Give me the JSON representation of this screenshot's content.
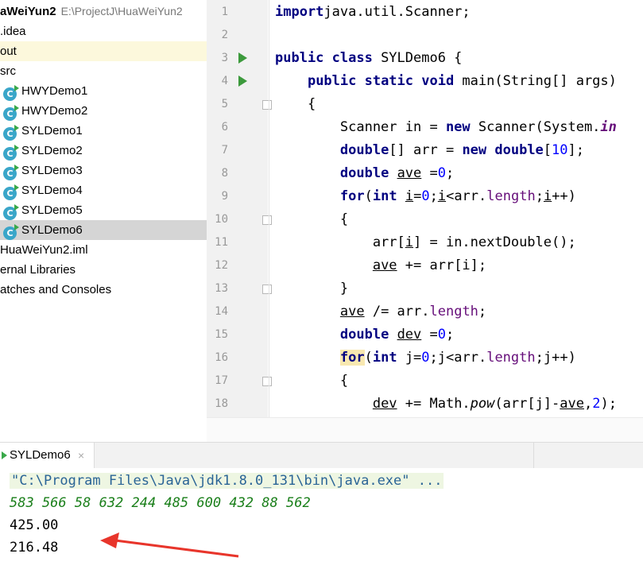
{
  "project": {
    "root_name": "aWeiYun2",
    "root_path": "E:\\ProjectJ\\HuaWeiYun2",
    "items": [
      {
        "label": ".idea",
        "indent": 0,
        "icon": "",
        "state": ""
      },
      {
        "label": "out",
        "indent": 0,
        "icon": "",
        "state": "highlight"
      },
      {
        "label": "src",
        "indent": 0,
        "icon": "",
        "state": ""
      },
      {
        "label": "HWYDemo1",
        "indent": 1,
        "icon": "java-class-icon",
        "state": ""
      },
      {
        "label": "HWYDemo2",
        "indent": 1,
        "icon": "java-class-icon",
        "state": ""
      },
      {
        "label": "SYLDemo1",
        "indent": 1,
        "icon": "java-class-icon",
        "state": ""
      },
      {
        "label": "SYLDemo2",
        "indent": 1,
        "icon": "java-class-icon",
        "state": ""
      },
      {
        "label": "SYLDemo3",
        "indent": 1,
        "icon": "java-class-icon",
        "state": ""
      },
      {
        "label": "SYLDemo4",
        "indent": 1,
        "icon": "java-class-icon",
        "state": ""
      },
      {
        "label": "SYLDemo5",
        "indent": 1,
        "icon": "java-class-icon",
        "state": ""
      },
      {
        "label": "SYLDemo6",
        "indent": 1,
        "icon": "java-class-icon",
        "state": "selected"
      },
      {
        "label": "HuaWeiYun2.iml",
        "indent": 0,
        "icon": "",
        "state": ""
      },
      {
        "label": "ernal Libraries",
        "indent": 0,
        "icon": "",
        "state": ""
      },
      {
        "label": "atches and Consoles",
        "indent": 0,
        "icon": "",
        "state": ""
      }
    ]
  },
  "editor": {
    "run_lines": [
      3,
      4
    ],
    "fold_lines": [
      5,
      10,
      13,
      17
    ],
    "lines": [
      [
        [
          "kw",
          "import"
        ],
        [
          "",
          "java.util.Scanner;"
        ]
      ],
      [],
      [
        [
          "kw",
          "public class"
        ],
        [
          "",
          " SYLDemo6 {"
        ]
      ],
      [
        [
          "",
          "    "
        ],
        [
          "kw",
          "public static void"
        ],
        [
          "",
          " main(String[] args)"
        ]
      ],
      [
        [
          "",
          "    {"
        ]
      ],
      [
        [
          "",
          "        Scanner in = "
        ],
        [
          "kw",
          "new"
        ],
        [
          "",
          " Scanner(System."
        ],
        [
          "fldi",
          "in"
        ]
      ],
      [
        [
          "",
          "        "
        ],
        [
          "kw",
          "double"
        ],
        [
          "",
          "[] arr = "
        ],
        [
          "kw",
          "new double"
        ],
        [
          "",
          "["
        ],
        [
          "num",
          "10"
        ],
        [
          "",
          "];"
        ]
      ],
      [
        [
          "",
          "        "
        ],
        [
          "kw",
          "double"
        ],
        [
          "",
          " "
        ],
        [
          "ul",
          "ave"
        ],
        [
          "",
          " ="
        ],
        [
          "num",
          "0"
        ],
        [
          "",
          ";"
        ]
      ],
      [
        [
          "",
          "        "
        ],
        [
          "kw",
          "for"
        ],
        [
          "",
          "("
        ],
        [
          "kw",
          "int"
        ],
        [
          "",
          " "
        ],
        [
          "ul",
          "i"
        ],
        [
          "",
          "="
        ],
        [
          "num",
          "0"
        ],
        [
          "",
          ";"
        ],
        [
          "ul",
          "i"
        ],
        [
          "",
          "<arr."
        ],
        [
          "fld",
          "length"
        ],
        [
          "",
          ";"
        ],
        [
          "ul",
          "i"
        ],
        [
          "",
          "++)"
        ]
      ],
      [
        [
          "",
          "        {"
        ]
      ],
      [
        [
          "",
          "            arr["
        ],
        [
          "ul",
          "i"
        ],
        [
          "",
          "] = in.nextDouble();"
        ]
      ],
      [
        [
          "",
          "            "
        ],
        [
          "ul",
          "ave"
        ],
        [
          "",
          " += arr[i];"
        ]
      ],
      [
        [
          "",
          "        }"
        ]
      ],
      [
        [
          "",
          "        "
        ],
        [
          "ul",
          "ave"
        ],
        [
          "",
          " /= arr."
        ],
        [
          "fld",
          "length"
        ],
        [
          "",
          ";"
        ]
      ],
      [
        [
          "",
          "        "
        ],
        [
          "kw",
          "double"
        ],
        [
          "",
          " "
        ],
        [
          "ul",
          "dev"
        ],
        [
          "",
          " ="
        ],
        [
          "num",
          "0"
        ],
        [
          "",
          ";"
        ]
      ],
      [
        [
          "",
          "        "
        ],
        [
          "kwm",
          "for"
        ],
        [
          "",
          "("
        ],
        [
          "kw",
          "int"
        ],
        [
          "",
          " j="
        ],
        [
          "num",
          "0"
        ],
        [
          "",
          ";j<arr."
        ],
        [
          "fld",
          "length"
        ],
        [
          "",
          ";j++)"
        ]
      ],
      [
        [
          "",
          "        {"
        ]
      ],
      [
        [
          "",
          "            "
        ],
        [
          "ul",
          "dev"
        ],
        [
          "",
          " += Math."
        ],
        [
          "static",
          "pow"
        ],
        [
          "",
          "(arr[j]-"
        ],
        [
          "ul",
          "ave"
        ],
        [
          "",
          ","
        ],
        [
          "num",
          "2"
        ],
        [
          "",
          ");"
        ]
      ]
    ]
  },
  "run_panel": {
    "tab_label": "SYLDemo6",
    "close_glyph": "×",
    "command": "\"C:\\Program Files\\Java\\jdk1.8.0_131\\bin\\java.exe\" ...",
    "input_line": "583 566 58 632 244 485 600 432 88 562",
    "output_lines": [
      "425.00",
      "216.48"
    ]
  },
  "annotation": {
    "color": "#e8352b"
  }
}
